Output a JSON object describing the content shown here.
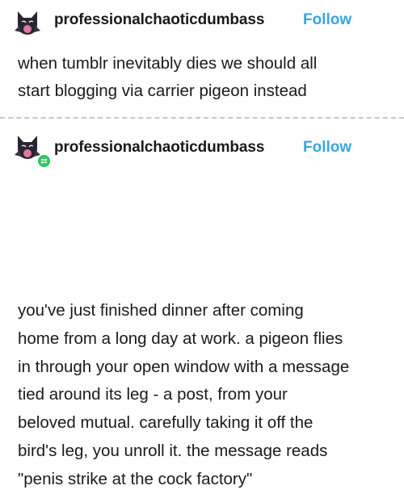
{
  "colors": {
    "follow": "#3aa4e0",
    "text": "#1a1a1a",
    "reblog_badge": "#2ec65b",
    "divider": "#c7c7c7"
  },
  "posts": [
    {
      "username": "professionalchaoticdumbass",
      "follow_label": "Follow",
      "avatar_icon": "cat-avatar-icon",
      "body": "when tumblr inevitably dies we should all\nstart blogging via carrier pigeon instead"
    },
    {
      "username": "professionalchaoticdumbass",
      "follow_label": "Follow",
      "avatar_icon": "cat-avatar-icon",
      "badge_icon": "reblog-icon",
      "body": "you've just finished dinner after coming\nhome from a long day at work. a pigeon flies\nin through your open window with a message\ntied around its leg - a post, from your\nbeloved mutual. carefully taking it off the\nbird's leg, you unroll it. the message reads\n\"penis strike at the cock factory\""
    }
  ]
}
